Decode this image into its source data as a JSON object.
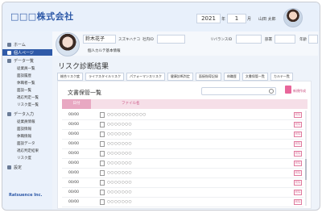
{
  "header": {
    "company": "□□□株式会社",
    "year": "2021",
    "year_unit": "年",
    "month": "1",
    "month_unit": "月",
    "user_label": "山田 太郎"
  },
  "sidebar": {
    "items": [
      {
        "label": "ホーム"
      },
      {
        "label": "個人ページ"
      },
      {
        "label": "データ一覧"
      }
    ],
    "sub_data": [
      "従業員一覧",
      "面談履歴",
      "休職者一覧",
      "面談一覧",
      "適応判定一覧",
      "リスク度一覧"
    ],
    "input_label": "データ入力",
    "sub_input": [
      "従業員情報",
      "面談情報",
      "休職情報",
      "面談データ",
      "適応判定結果",
      "リスク度"
    ],
    "settings": "設定",
    "logo": "Ratsuence Inc."
  },
  "profile": {
    "name": "鈴木花子",
    "kana": "スズキハナコ",
    "fields": [
      "社内ID",
      "リバランスID",
      "部署",
      "年齢"
    ],
    "karte_link": "個人カルテ基本情報"
  },
  "page": {
    "title": "リスク診断結果"
  },
  "tabs": [
    "総合リスク度",
    "ライフスタイルリスク",
    "パフォーマンスリスク",
    "健康診断判定",
    "面接指導記録",
    "休職歴",
    "文書保管一覧",
    "カルテ一覧"
  ],
  "documents": {
    "title": "文書保管一覧",
    "new_label": "新規作成",
    "headers": {
      "date": "日付",
      "file": "ファイル名"
    },
    "rows": [
      {
        "date": "00/00",
        "file": "○○○○○○○○○○○",
        "del": "削除"
      },
      {
        "date": "00/00",
        "file": "○○○○○○○",
        "del": "削除"
      },
      {
        "date": "00/00",
        "file": "○○○○○○○",
        "del": "削除"
      },
      {
        "date": "00/00",
        "file": "○○○○○○○",
        "del": "削除"
      },
      {
        "date": "00/00",
        "file": "○○○○○○○",
        "del": "削除"
      },
      {
        "date": "00/00",
        "file": "○○○○○○○",
        "del": "削除"
      },
      {
        "date": "00/00",
        "file": "○○○○○○○",
        "del": "削除"
      },
      {
        "date": "00/00",
        "file": "○○○○○○○",
        "del": "削除"
      },
      {
        "date": "00/00",
        "file": "○○○○○○○",
        "del": "削除"
      },
      {
        "date": "00/00",
        "file": "○○○○○○○",
        "del": "削除"
      }
    ]
  }
}
